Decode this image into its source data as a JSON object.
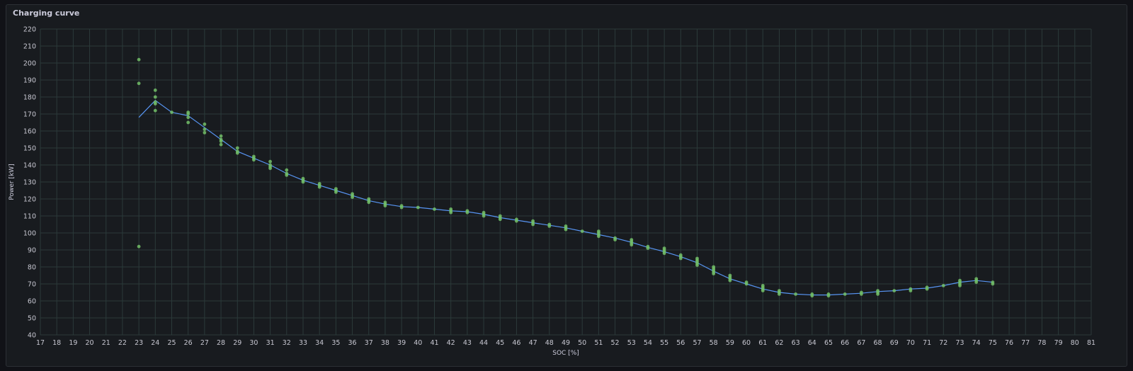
{
  "panel": {
    "title": "Charging curve"
  },
  "chart_data": {
    "type": "scatter",
    "title": "Charging curve",
    "xlabel": "SOC [%]",
    "ylabel": "Power [kW]",
    "xlim": [
      17,
      81
    ],
    "ylim": [
      40,
      220
    ],
    "xticks": [
      17,
      18,
      19,
      20,
      21,
      22,
      23,
      24,
      25,
      26,
      27,
      28,
      29,
      30,
      31,
      32,
      33,
      34,
      35,
      36,
      37,
      38,
      39,
      40,
      41,
      42,
      43,
      44,
      45,
      46,
      47,
      48,
      49,
      50,
      51,
      52,
      53,
      54,
      55,
      56,
      57,
      58,
      59,
      60,
      61,
      62,
      63,
      64,
      65,
      66,
      67,
      68,
      69,
      70,
      71,
      72,
      73,
      74,
      75,
      76,
      77,
      78,
      79,
      80,
      81
    ],
    "yticks": [
      40,
      50,
      60,
      70,
      80,
      90,
      100,
      110,
      120,
      130,
      140,
      150,
      160,
      170,
      180,
      190,
      200,
      210,
      220
    ],
    "grid": true,
    "colors": {
      "points": "#73bf69",
      "line": "#5794f2"
    },
    "series": [
      {
        "kind": "points",
        "points": [
          [
            23,
            202
          ],
          [
            23,
            188
          ],
          [
            23,
            92
          ],
          [
            24,
            184
          ],
          [
            24,
            180
          ],
          [
            24,
            177
          ],
          [
            24,
            176
          ],
          [
            24,
            172
          ],
          [
            25,
            171
          ],
          [
            26,
            171
          ],
          [
            26,
            170
          ],
          [
            26,
            168
          ],
          [
            26,
            165
          ],
          [
            27,
            164
          ],
          [
            27,
            161
          ],
          [
            27,
            159
          ],
          [
            28,
            157
          ],
          [
            28,
            155
          ],
          [
            28,
            154
          ],
          [
            28,
            152
          ],
          [
            29,
            150
          ],
          [
            29,
            148
          ],
          [
            29,
            147
          ],
          [
            30,
            145
          ],
          [
            30,
            144
          ],
          [
            30,
            143
          ],
          [
            31,
            142
          ],
          [
            31,
            140
          ],
          [
            31,
            139
          ],
          [
            31,
            138
          ],
          [
            32,
            137
          ],
          [
            32,
            135
          ],
          [
            32,
            134
          ],
          [
            33,
            132
          ],
          [
            33,
            131
          ],
          [
            33,
            130
          ],
          [
            34,
            129
          ],
          [
            34,
            128
          ],
          [
            34,
            127
          ],
          [
            35,
            126
          ],
          [
            35,
            125
          ],
          [
            35,
            124
          ],
          [
            36,
            123
          ],
          [
            36,
            122
          ],
          [
            36,
            121
          ],
          [
            37,
            120
          ],
          [
            37,
            119
          ],
          [
            37,
            118
          ],
          [
            38,
            118
          ],
          [
            38,
            117
          ],
          [
            38,
            116
          ],
          [
            39,
            116
          ],
          [
            39,
            115
          ],
          [
            40,
            115
          ],
          [
            41,
            114
          ],
          [
            42,
            114
          ],
          [
            42,
            113
          ],
          [
            42,
            112
          ],
          [
            43,
            113
          ],
          [
            43,
            112
          ],
          [
            44,
            112
          ],
          [
            44,
            111
          ],
          [
            44,
            110
          ],
          [
            45,
            110
          ],
          [
            45,
            109
          ],
          [
            45,
            108
          ],
          [
            46,
            108
          ],
          [
            46,
            107
          ],
          [
            47,
            107
          ],
          [
            47,
            106
          ],
          [
            47,
            105
          ],
          [
            48,
            105
          ],
          [
            48,
            104
          ],
          [
            49,
            104
          ],
          [
            49,
            103
          ],
          [
            49,
            102
          ],
          [
            50,
            101
          ],
          [
            51,
            101
          ],
          [
            51,
            100
          ],
          [
            51,
            99
          ],
          [
            51,
            98
          ],
          [
            52,
            97
          ],
          [
            52,
            96
          ],
          [
            53,
            96
          ],
          [
            53,
            95
          ],
          [
            53,
            94
          ],
          [
            53,
            93
          ],
          [
            54,
            92
          ],
          [
            54,
            91
          ],
          [
            55,
            91
          ],
          [
            55,
            90
          ],
          [
            55,
            89
          ],
          [
            55,
            88
          ],
          [
            56,
            87
          ],
          [
            56,
            86
          ],
          [
            56,
            85
          ],
          [
            57,
            85
          ],
          [
            57,
            84
          ],
          [
            57,
            83
          ],
          [
            57,
            82
          ],
          [
            57,
            81
          ],
          [
            58,
            80
          ],
          [
            58,
            79
          ],
          [
            58,
            78
          ],
          [
            58,
            77
          ],
          [
            58,
            76
          ],
          [
            59,
            75
          ],
          [
            59,
            74
          ],
          [
            59,
            73
          ],
          [
            59,
            72
          ],
          [
            60,
            71
          ],
          [
            60,
            70
          ],
          [
            61,
            69
          ],
          [
            61,
            68
          ],
          [
            61,
            67
          ],
          [
            61,
            66
          ],
          [
            62,
            66
          ],
          [
            62,
            65
          ],
          [
            62,
            64
          ],
          [
            63,
            64
          ],
          [
            64,
            64
          ],
          [
            64,
            63
          ],
          [
            65,
            64
          ],
          [
            65,
            63
          ],
          [
            66,
            64
          ],
          [
            67,
            65
          ],
          [
            67,
            64
          ],
          [
            68,
            66
          ],
          [
            68,
            65
          ],
          [
            68,
            64
          ],
          [
            69,
            66
          ],
          [
            70,
            67
          ],
          [
            70,
            66
          ],
          [
            71,
            68
          ],
          [
            71,
            67
          ],
          [
            72,
            69
          ],
          [
            73,
            72
          ],
          [
            73,
            71
          ],
          [
            73,
            70
          ],
          [
            73,
            69
          ],
          [
            74,
            73
          ],
          [
            74,
            72
          ],
          [
            74,
            71
          ],
          [
            75,
            71
          ],
          [
            75,
            70
          ]
        ]
      },
      {
        "kind": "line",
        "points": [
          [
            23,
            168
          ],
          [
            24,
            178
          ],
          [
            25,
            171
          ],
          [
            26,
            169
          ],
          [
            27,
            162
          ],
          [
            28,
            155
          ],
          [
            29,
            148
          ],
          [
            30,
            144
          ],
          [
            31,
            140
          ],
          [
            32,
            135
          ],
          [
            33,
            131
          ],
          [
            34,
            128
          ],
          [
            35,
            125
          ],
          [
            36,
            122
          ],
          [
            37,
            119
          ],
          [
            38,
            117
          ],
          [
            39,
            115.5
          ],
          [
            40,
            115
          ],
          [
            41,
            114
          ],
          [
            42,
            113
          ],
          [
            43,
            112.5
          ],
          [
            44,
            111
          ],
          [
            45,
            109
          ],
          [
            46,
            107.5
          ],
          [
            47,
            106
          ],
          [
            48,
            104.5
          ],
          [
            49,
            103
          ],
          [
            50,
            101
          ],
          [
            51,
            99
          ],
          [
            52,
            97
          ],
          [
            53,
            94.5
          ],
          [
            54,
            91.5
          ],
          [
            55,
            89
          ],
          [
            56,
            86
          ],
          [
            57,
            82.5
          ],
          [
            58,
            77.5
          ],
          [
            59,
            73
          ],
          [
            60,
            70
          ],
          [
            61,
            67
          ],
          [
            62,
            65
          ],
          [
            63,
            64
          ],
          [
            64,
            63.5
          ],
          [
            65,
            63.5
          ],
          [
            66,
            64
          ],
          [
            67,
            64.5
          ],
          [
            68,
            65.5
          ],
          [
            69,
            66
          ],
          [
            70,
            67
          ],
          [
            71,
            67.5
          ],
          [
            72,
            69
          ],
          [
            73,
            71
          ],
          [
            74,
            72
          ],
          [
            75,
            71
          ]
        ]
      }
    ]
  }
}
